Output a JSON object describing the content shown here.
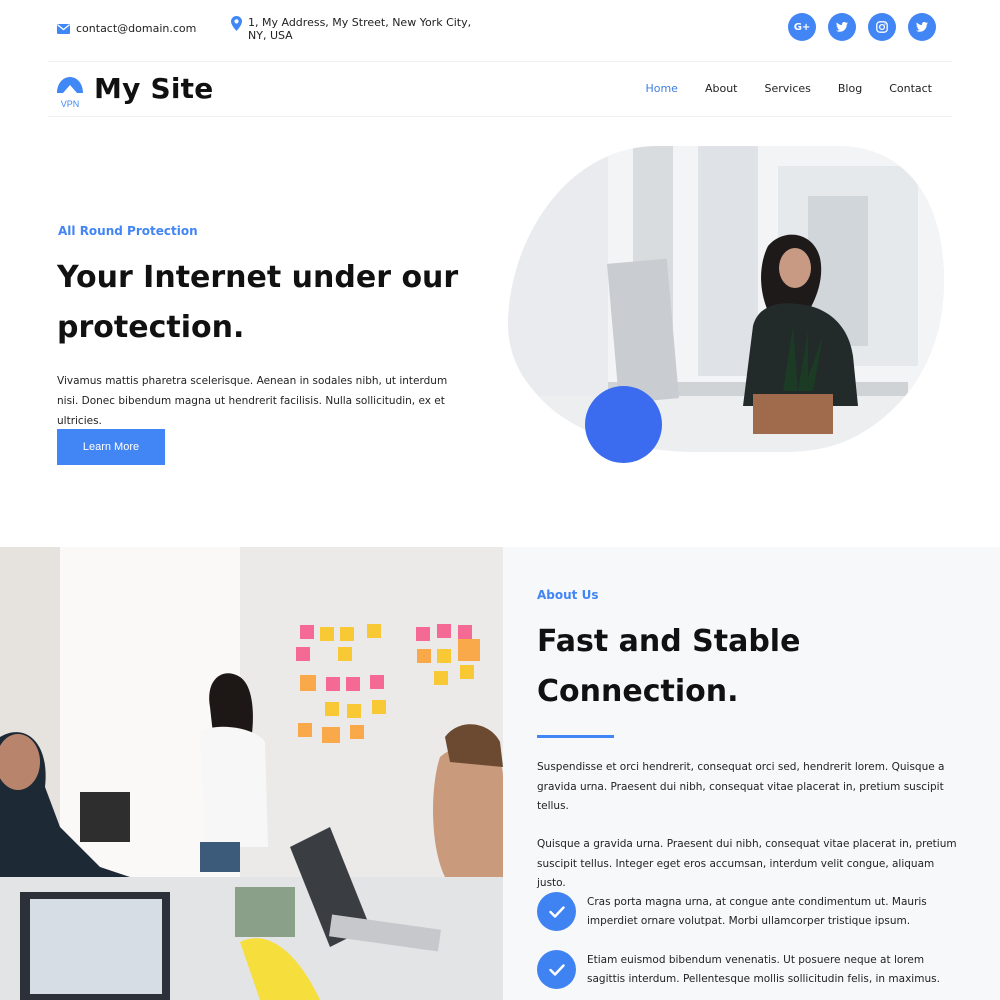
{
  "topbar": {
    "email": "contact@domain.com",
    "address": "1, My Address, My Street, New York City, NY, USA",
    "socials": [
      {
        "icon": "google-plus-icon",
        "label": "G+"
      },
      {
        "icon": "twitter-icon",
        "label": ""
      },
      {
        "icon": "instagram-icon",
        "label": ""
      },
      {
        "icon": "twitter-icon",
        "label": ""
      }
    ]
  },
  "nav": {
    "logo_badge": "VPN",
    "site_name": "My Site",
    "links": [
      "Home",
      "About",
      "Services",
      "Blog",
      "Contact"
    ],
    "active": "Home"
  },
  "hero": {
    "eyebrow": "All Round Protection",
    "title": "Your Internet under our protection.",
    "text": "Vivamus mattis pharetra scelerisque. Aenean in sodales nibh, ut interdum nisi. Donec bibendum magna ut hendrerit facilisis. Nulla sollicitudin, ex et ultricies.",
    "button": "Learn More"
  },
  "about": {
    "eyebrow": "About Us",
    "title": "Fast and Stable Connection.",
    "paragraph1": "Suspendisse et orci hendrerit, consequat orci sed, hendrerit lorem. Quisque a gravida urna. Praesent dui nibh, consequat vitae placerat in, pretium suscipit tellus.",
    "paragraph2": "Quisque a gravida urna. Praesent dui nibh, consequat vitae placerat in, pretium suscipit tellus. Integer eget eros accumsan, interdum velit congue, aliquam justo.",
    "features": [
      "Cras porta magna urna, at congue ante condimentum ut. Mauris imperdiet ornare volutpat. Morbi ullamcorper tristique ipsum.",
      "Etiam euismod bibendum venenatis. Ut posuere neque at lorem sagittis interdum. Pellentesque mollis sollicitudin felis, in maximus."
    ]
  },
  "colors": {
    "accent": "#4285f4",
    "dot": "#3b6cf0",
    "panel": "#f7f8fa"
  }
}
